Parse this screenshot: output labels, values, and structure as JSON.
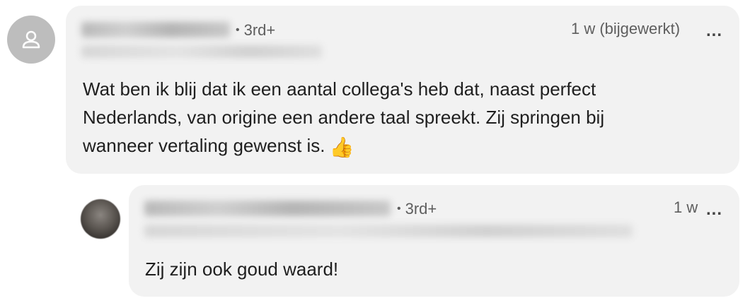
{
  "comment": {
    "degree": "3rd+",
    "time": "1 w  (bijgewerkt)",
    "more_label": "...",
    "text_lines": [
      "Wat ben ik blij dat ik een aantal collega's heb dat, naast perfect",
      "Nederlands, van origine een andere taal spreekt. Zij springen bij",
      "wanneer vertaling gewenst is."
    ],
    "emoji": "👍"
  },
  "reply": {
    "degree": "3rd+",
    "time": "1 w",
    "more_label": "...",
    "text": "Zij zijn ook goud waard!"
  }
}
